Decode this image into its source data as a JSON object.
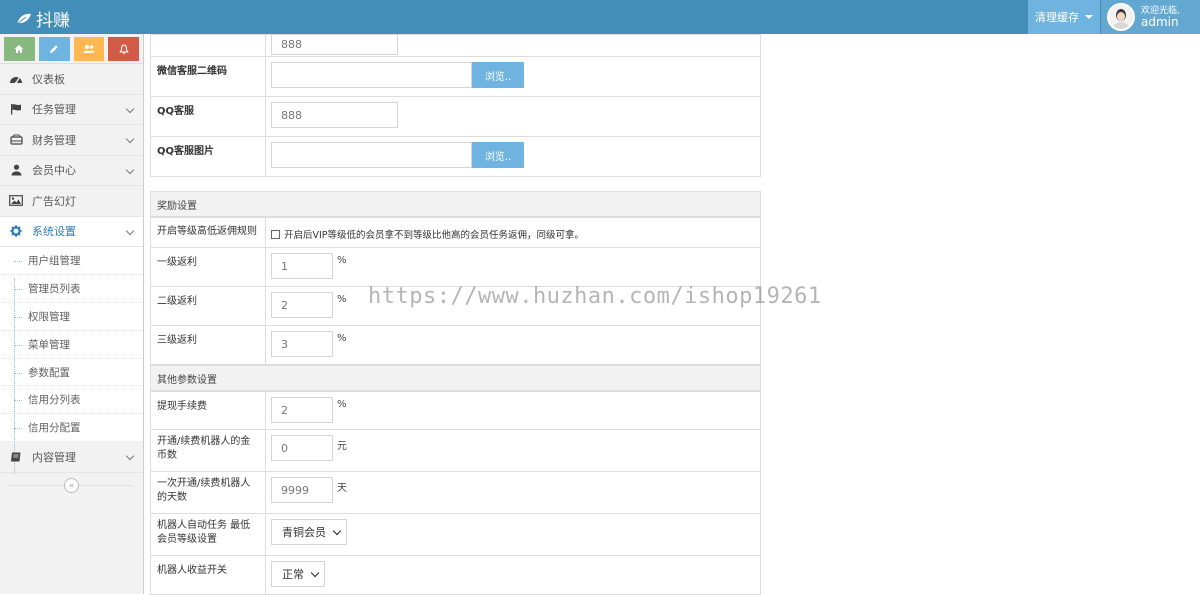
{
  "navbar": {
    "brand": "抖赚",
    "clear_cache": "清理缓存",
    "welcome": "欢迎光临,",
    "username": "admin"
  },
  "sidebar": {
    "shortcut_icons": [
      "home-icon",
      "pencil-icon",
      "users-icon",
      "bell-icon"
    ],
    "items": [
      {
        "label": "仪表板",
        "icon": "dashboard-icon"
      },
      {
        "label": "任务管理",
        "icon": "flag-icon"
      },
      {
        "label": "财务管理",
        "icon": "hdd-icon"
      },
      {
        "label": "会员中心",
        "icon": "user-icon"
      },
      {
        "label": "广告幻灯",
        "icon": "picture-icon"
      },
      {
        "label": "系统设置",
        "icon": "gear-icon"
      },
      {
        "label": "内容管理",
        "icon": "book-icon"
      }
    ],
    "subitems": [
      "用户组管理",
      "管理员列表",
      "权限管理",
      "菜单管理",
      "参数配置",
      "信用分列表",
      "信用分配置"
    ],
    "collapse_symbol": "«"
  },
  "form": {
    "wechat_id_value": "888",
    "wechat_qr_label": "微信客服二维码",
    "browse": "浏览..",
    "qq_label": "QQ客服",
    "qq_value": "888",
    "qq_image_label": "QQ客服图片",
    "reward_section": "奖励设置",
    "rebate_rule_label": "开启等级高低返佣规则",
    "rebate_rule_text": "开启后VIP等级低的会员拿不到等级比他高的会员任务返佣，同级可拿。",
    "level1_label": "一级返利",
    "level1_value": "1",
    "level2_label": "二级返利",
    "level2_value": "2",
    "level3_label": "三级返利",
    "level3_value": "3",
    "percent": "%",
    "other_section": "其他参数设置",
    "fee_label": "提现手续费",
    "fee_value": "2",
    "robot_coins_label": "开通/续费机器人的金币数",
    "robot_coins_value": "0",
    "robot_coins_unit": "元",
    "robot_days_label": "一次开通/续费机器人的天数",
    "robot_days_value": "9999",
    "robot_days_unit": "天",
    "robot_level_label": "机器人自动任务 最低会员等级设置",
    "robot_level_value": "青铜会员",
    "robot_income_label": "机器人收益开关",
    "robot_income_value": "正常"
  },
  "watermark": "https://www.huzhan.com/ishop19261"
}
